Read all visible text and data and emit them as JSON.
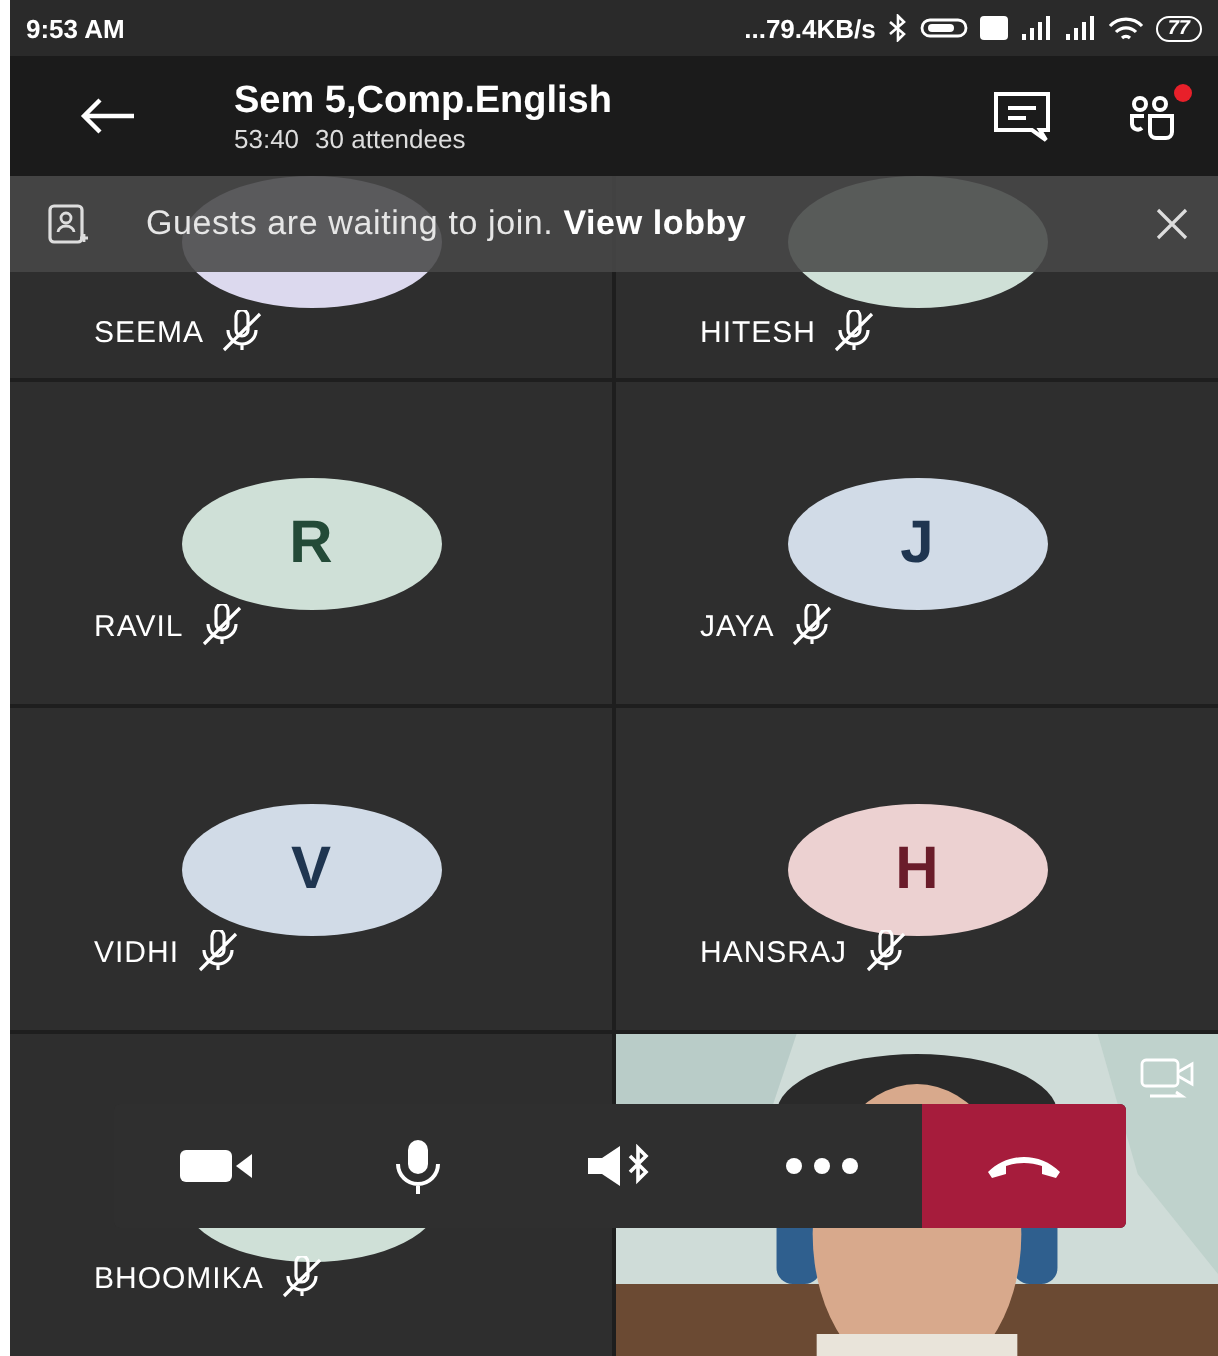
{
  "status_bar": {
    "time": "9:53 AM",
    "speed": "...79.4KB/s",
    "battery": "77"
  },
  "header": {
    "title": "Sem 5,Comp.English",
    "duration": "53:40",
    "attendees": "30 attendees",
    "people_alert": true
  },
  "banner": {
    "message": "Guests are waiting to join.",
    "link": "View lobby"
  },
  "tiles": [
    {
      "kind": "avatar",
      "name": "SEEMA",
      "muted": true,
      "color": "#dcd9ee"
    },
    {
      "kind": "avatar",
      "name": "HITESH",
      "muted": true,
      "color": "#cfe0d7"
    },
    {
      "kind": "avatar",
      "name": "RAVIL",
      "initial": "R",
      "muted": true,
      "color": "#cfe0d7"
    },
    {
      "kind": "avatar",
      "name": "JAYA",
      "initial": "J",
      "muted": true,
      "color": "#d1dbe7"
    },
    {
      "kind": "avatar",
      "name": "VIDHI",
      "initial": "V",
      "muted": true,
      "color": "#d1dbe7"
    },
    {
      "kind": "avatar",
      "name": "HANSRAJ",
      "initial": "H",
      "muted": true,
      "color": "#ecd1d1"
    },
    {
      "kind": "avatar",
      "name": "BHOOMIKA",
      "muted": true,
      "color": "#cfe0d7"
    },
    {
      "kind": "video"
    }
  ]
}
